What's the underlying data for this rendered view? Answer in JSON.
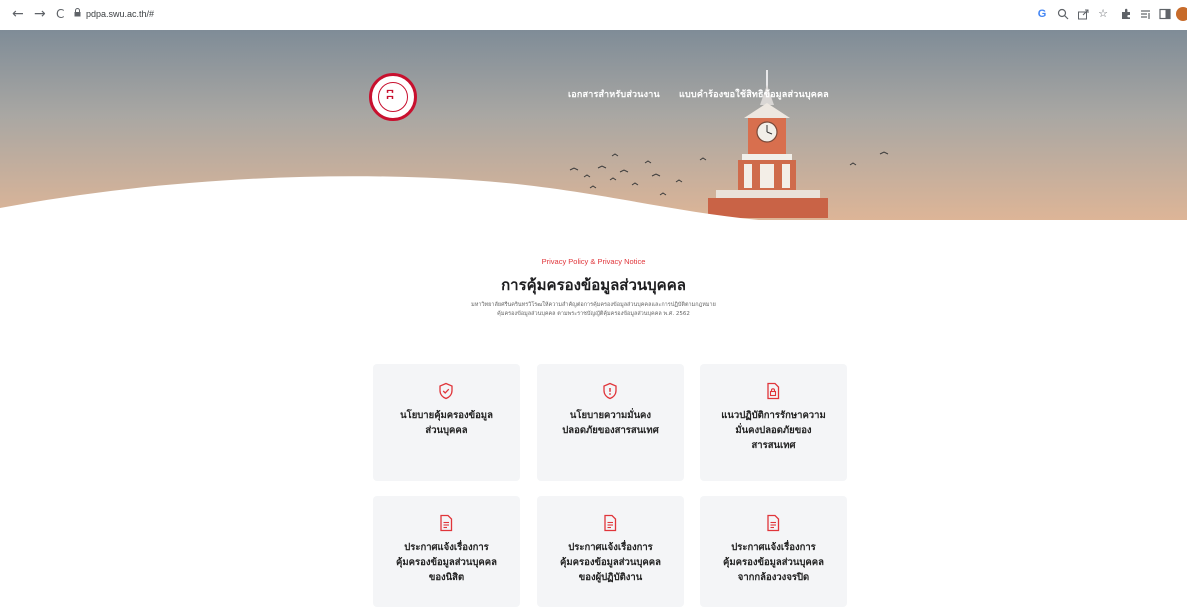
{
  "browser": {
    "url": "pdpa.swu.ac.th/#",
    "back": "←",
    "forward": "→",
    "reload": "C"
  },
  "hero": {
    "nav": [
      {
        "label": "เอกสารสำหรับส่วนงาน"
      },
      {
        "label": "แบบคำร้องขอใช้สิทธิข้อมูลส่วนบุคคล"
      }
    ]
  },
  "section": {
    "kicker": "Privacy Policy & Privacy Notice",
    "title": "การคุ้มครองข้อมูลส่วนบุคคล",
    "desc_line1": "มหาวิทยาลัยศรีนครินทรวิโรฒให้ความสำคัญต่อการคุ้มครองข้อมูลส่วนบุคคลและการปฏิบัติตามกฎหมาย",
    "desc_line2": "คุ้มครองข้อมูลส่วนบุคคล ตามพระราชบัญญัติคุ้มครองข้อมูลส่วนบุคคล พ.ศ. 2562"
  },
  "cards": [
    {
      "label": "นโยบายคุ้มครองข้อมูล\nส่วนบุคคล",
      "icon": "shield-check-icon"
    },
    {
      "label": "นโยบายความมั่นคง\nปลอดภัยของสารสนเทศ",
      "icon": "shield-alert-icon"
    },
    {
      "label": "แนวปฏิบัติการรักษาความ\nมั่นคงปลอดภัยของ\nสารสนเทศ",
      "icon": "document-lock-icon"
    },
    {
      "label": "ประกาศแจ้งเรื่องการ\nคุ้มครองข้อมูลส่วนบุคคล\nของนิสิต",
      "icon": "document-icon"
    },
    {
      "label": "ประกาศแจ้งเรื่องการ\nคุ้มครองข้อมูลส่วนบุคคล\nของผู้ปฏิบัติงาน",
      "icon": "document-icon"
    },
    {
      "label": "ประกาศแจ้งเรื่องการ\nคุ้มครองข้อมูลส่วนบุคคล\nจากกล้องวงจรปิด",
      "icon": "document-icon"
    }
  ],
  "colors": {
    "accent": "#e0353a",
    "card_bg": "#f4f5f7"
  }
}
